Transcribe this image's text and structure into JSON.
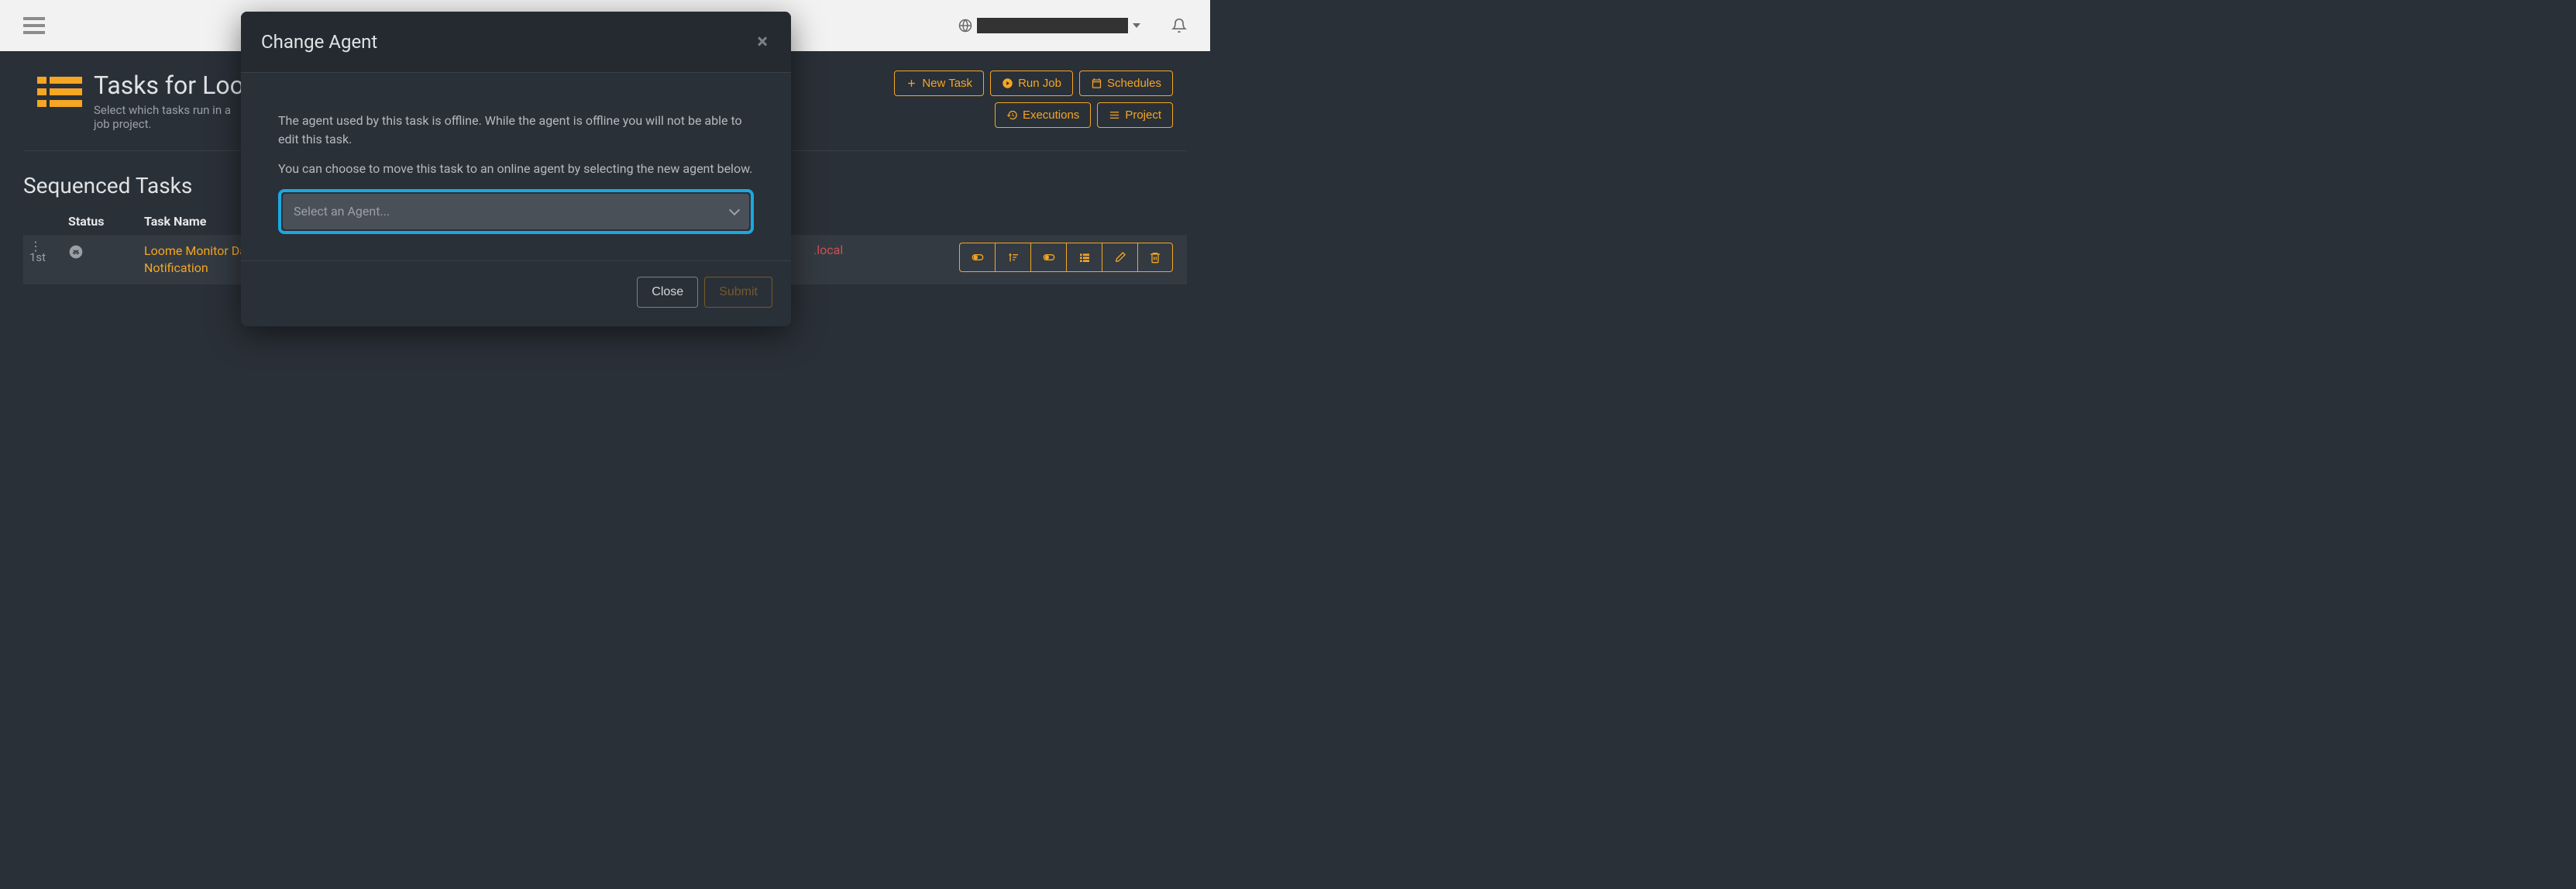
{
  "topbar": {
    "globe_label": "",
    "globe_redacted": true
  },
  "page": {
    "title": "Tasks for Loom",
    "subtitle": "Select which tasks run in a job project."
  },
  "actions": {
    "new_task": "New Task",
    "run_job": "Run Job",
    "schedules": "Schedules",
    "executions": "Executions",
    "project": "Project"
  },
  "section": {
    "title": "Sequenced Tasks",
    "col_status": "Status",
    "col_name": "Task Name"
  },
  "tasks": [
    {
      "order": "1st",
      "name": "Loome Monitor Data Issues Notification",
      "agent_suffix": ".local"
    }
  ],
  "modal": {
    "title": "Change Agent",
    "body1": "The agent used by this task is offline. While the agent is offline you will not be able to edit this task.",
    "body2": "You can choose to move this task to an online agent by selecting the new agent below.",
    "select_placeholder": "Select an Agent...",
    "close": "Close",
    "submit": "Submit"
  }
}
